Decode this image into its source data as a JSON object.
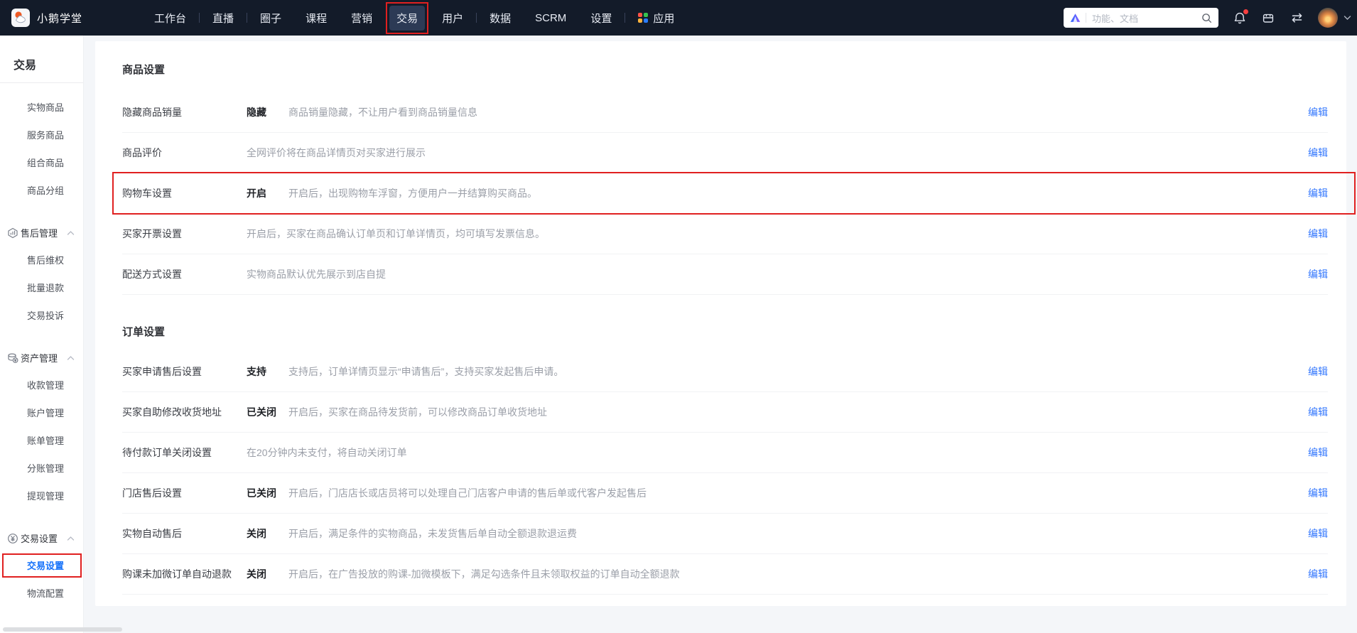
{
  "topbar": {
    "brand": "小鹅学堂",
    "search_placeholder": "功能、文档",
    "nav": [
      {
        "key": "workbench",
        "label": "工作台",
        "sep_after": true
      },
      {
        "key": "live",
        "label": "直播",
        "sep_after": true
      },
      {
        "key": "community",
        "label": "圈子"
      },
      {
        "key": "course",
        "label": "课程"
      },
      {
        "key": "marketing",
        "label": "营销"
      },
      {
        "key": "trade",
        "label": "交易",
        "active": true,
        "annotated": true
      },
      {
        "key": "users",
        "label": "用户",
        "sep_after": true
      },
      {
        "key": "data",
        "label": "数据"
      },
      {
        "key": "scrm",
        "label": "SCRM"
      },
      {
        "key": "settings",
        "label": "设置",
        "sep_after": true
      },
      {
        "key": "apps",
        "label": "应用",
        "app_icon": true
      }
    ],
    "right_icons": [
      {
        "key": "notifications-bell",
        "badge": true
      },
      {
        "key": "store"
      },
      {
        "key": "switch-arrows"
      }
    ],
    "app_grid_colors": [
      "#ff5246",
      "#37c24f",
      "#ffb43c",
      "#2a7dff"
    ]
  },
  "sidebar": {
    "title": "交易",
    "sections": [
      {
        "items": [
          {
            "key": "physical-goods",
            "label": "实物商品"
          },
          {
            "key": "service-goods",
            "label": "服务商品"
          },
          {
            "key": "bundle-goods",
            "label": "组合商品"
          },
          {
            "key": "goods-groups",
            "label": "商品分组"
          }
        ]
      },
      {
        "key": "aftersale-management",
        "header": "售后管理",
        "icon": "aftersale",
        "items": [
          {
            "key": "aftersale-rights",
            "label": "售后维权"
          },
          {
            "key": "batch-refund",
            "label": "批量退款"
          },
          {
            "key": "trade-complaints",
            "label": "交易投诉"
          }
        ]
      },
      {
        "key": "asset-management",
        "header": "资产管理",
        "icon": "asset",
        "items": [
          {
            "key": "payment-collection",
            "label": "收款管理"
          },
          {
            "key": "account-management",
            "label": "账户管理"
          },
          {
            "key": "bill-management",
            "label": "账单管理"
          },
          {
            "key": "ledger-split",
            "label": "分账管理"
          },
          {
            "key": "withdrawal",
            "label": "提现管理"
          }
        ]
      },
      {
        "key": "trade-settings-group",
        "header": "交易设置",
        "icon": "trade",
        "items": [
          {
            "key": "trade-settings",
            "label": "交易设置",
            "active": true,
            "annotated": true
          },
          {
            "key": "logistics-config",
            "label": "物流配置"
          }
        ]
      }
    ]
  },
  "main": {
    "sections": [
      {
        "key": "goods-settings",
        "title": "商品设置",
        "rows": [
          {
            "key": "hide-sales",
            "label": "隐藏商品销量",
            "status": "隐藏",
            "desc": "商品销量隐藏，不让用户看到商品销量信息",
            "action": "编辑"
          },
          {
            "key": "product-review",
            "label": "商品评价",
            "status": "",
            "desc": "全网评价将在商品详情页对买家进行展示",
            "action": "编辑"
          },
          {
            "key": "cart-settings",
            "label": "购物车设置",
            "status": "开启",
            "desc": "开启后，出现购物车浮窗，方便用户一并结算购买商品。",
            "action": "编辑",
            "annotated": true
          },
          {
            "key": "buyer-invoice",
            "label": "买家开票设置",
            "status": "",
            "desc": "开启后，买家在商品确认订单页和订单详情页，均可填写发票信息。",
            "action": "编辑"
          },
          {
            "key": "delivery-method",
            "label": "配送方式设置",
            "status": "",
            "desc": "实物商品默认优先展示到店自提",
            "action": "编辑"
          }
        ]
      },
      {
        "key": "order-settings",
        "title": "订单设置",
        "rows": [
          {
            "key": "buyer-aftersale",
            "label": "买家申请售后设置",
            "status": "支持",
            "desc": "支持后，订单详情页显示“申请售后”，支持买家发起售后申请。",
            "action": "编辑"
          },
          {
            "key": "buyer-edit-address",
            "label": "买家自助修改收货地址",
            "status": "已关闭",
            "desc": "开启后，买家在商品待发货前，可以修改商品订单收货地址",
            "action": "编辑"
          },
          {
            "key": "unpaid-order-close",
            "label": "待付款订单关闭设置",
            "status": "",
            "desc": "在20分钟内未支付，将自动关闭订单",
            "action": "编辑"
          },
          {
            "key": "store-aftersale",
            "label": "门店售后设置",
            "status": "已关闭",
            "desc": "开启后，门店店长或店员将可以处理自己门店客户申请的售后单或代客户发起售后",
            "action": "编辑"
          },
          {
            "key": "physical-auto-aftersale",
            "label": "实物自动售后",
            "status": "关闭",
            "desc": "开启后，满足条件的实物商品，未发货售后单自动全额退款退运费",
            "action": "编辑"
          },
          {
            "key": "course-auto-refund",
            "label": "购课未加微订单自动退款",
            "status": "关闭",
            "desc": "开启后，在广告投放的购课-加微模板下，满足勾选条件且未领取权益的订单自动全额退款",
            "action": "编辑"
          }
        ]
      }
    ]
  },
  "colors": {
    "topbar_bg": "#131b29",
    "nav_active_bg": "#2c3a55",
    "annotation_red": "#e02020",
    "edit_link_blue": "#3377fe",
    "sidebar_active_blue": "#1672fa",
    "page_bg": "#f4f6f9",
    "card_bg": "#ffffff",
    "status_bold": "#1f2126",
    "desc_gray": "#9b9fa8"
  },
  "icons": {
    "brand-logo": "goose-in-rounded-square",
    "search-logo": "gradient-triangle",
    "search": "magnifier",
    "notifications-bell": "bell-with-red-dot",
    "store": "storefront-box",
    "switch-arrows": "double-horizontal-arrows",
    "chevron-down": "v-chevron",
    "app-grid": "four-color-dots",
    "aftersale": "hexagon-bar-chart",
    "asset": "coins-stack-yuan",
    "trade": "yuan-coin-badge",
    "group-chevron": "chevron-up"
  }
}
